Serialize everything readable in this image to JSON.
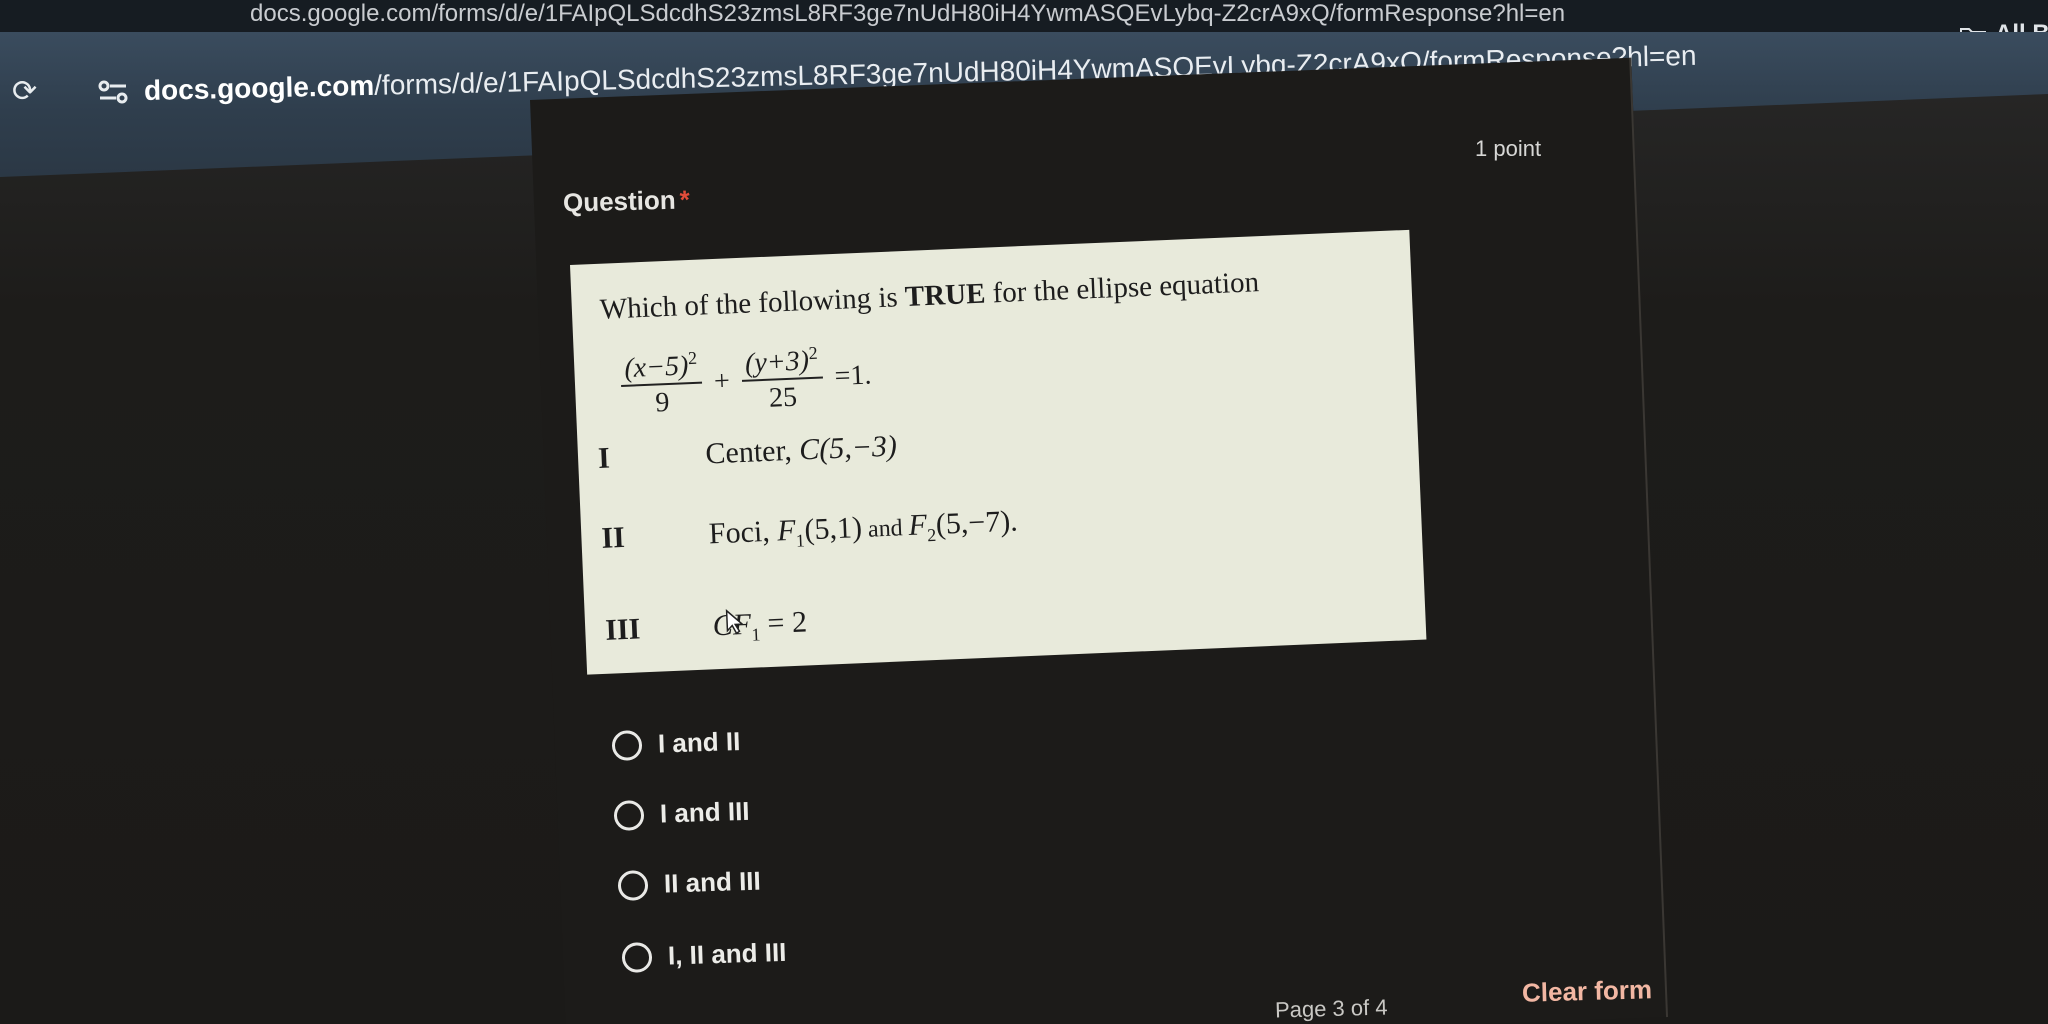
{
  "browser": {
    "tab_title": "docs.google.com/forms/d/e/1FAIpQLSdcdhS23zmsL8RF3ge7nUdH80iH4YwmASQEvLybq-Z2crA9xQ/formResponse?hl=en",
    "url_host": "docs.google.com",
    "url_path": "/forms/d/e/1FAIpQLSdcdhS23zmsL8RF3ge7nUdH80iH4YwmASQEvLybq-Z2crA9xQ/formResponse?hl=en",
    "bookmarks_label": "All Bo",
    "icons": {
      "refresh": "refresh-icon",
      "site_info": "site-settings-icon",
      "bookmarks": "folder-icon"
    }
  },
  "form": {
    "points": "1 point",
    "question_title": "Question",
    "required_marker": "*",
    "question_image": {
      "prompt_start": "Which of the following is ",
      "prompt_bold": "TRUE",
      "prompt_end": " for the ellipse equation",
      "equation": {
        "term1_num": "(x−5)",
        "term1_den": "9",
        "term2_num": "(y+3)",
        "term2_den": "25",
        "exponent": "2",
        "plus": "+",
        "rhs": "=1."
      },
      "statements": [
        {
          "numeral": "I",
          "text": "Center, ",
          "math": "C(5,−3)"
        },
        {
          "numeral": "II",
          "text": "Foci, ",
          "math1": "F",
          "sub1": "1",
          "val1": "(5,1)",
          "and": " and ",
          "math2": "F",
          "sub2": "2",
          "val2": "(5,−7)."
        },
        {
          "numeral": "III",
          "math": "CF",
          "sub": "1",
          "val": " = 2"
        }
      ]
    },
    "options": [
      "I and II",
      "I and III",
      "II and III",
      "I, II and III"
    ],
    "page_indicator": "Page 3 of 4",
    "clear_form": "Clear form"
  },
  "colors": {
    "required": "#e24c3a",
    "clear_form": "#f2b7a3",
    "paper": "#e8eadb",
    "address_bar": "#34495b"
  }
}
